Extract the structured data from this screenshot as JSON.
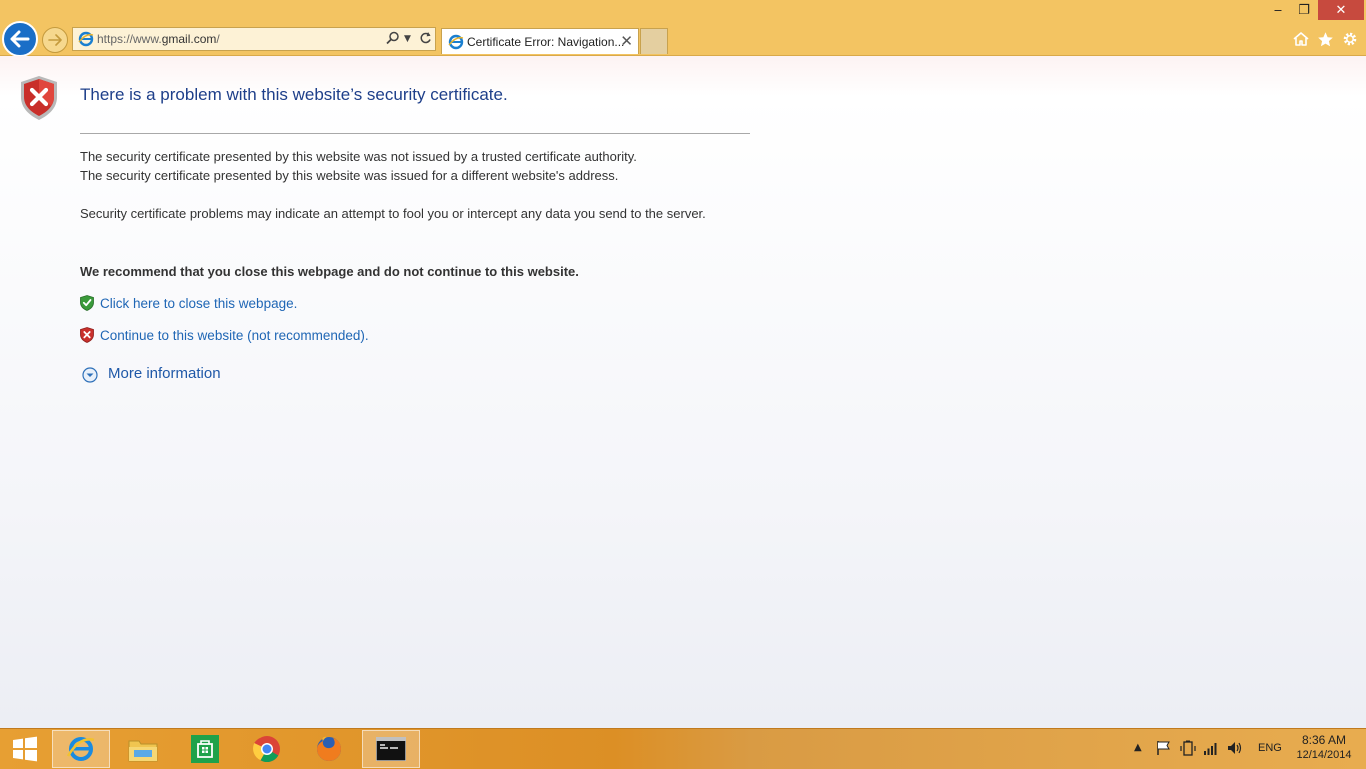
{
  "browser": {
    "url_scheme": "https://www.",
    "url_domain": "gmail.com",
    "url_path": "/",
    "tab_title": "Certificate Error: Navigation...",
    "window_controls": {
      "minimize": "‒",
      "restore": "❐",
      "close": "✕"
    },
    "toolbar_icons": [
      "home-icon",
      "favorites-star-icon",
      "tools-gear-icon"
    ]
  },
  "page": {
    "heading": "There is a problem with this website’s security certificate.",
    "line1": "The security certificate presented by this website was not issued by a trusted certificate authority.",
    "line2": "The security certificate presented by this website was issued for a different website's address.",
    "paragraph2": "Security certificate problems may indicate an attempt to fool you or intercept any data you send to the server.",
    "recommendation": "We recommend that you close this webpage and do not continue to this website.",
    "close_link": "Click here to close this webpage.",
    "continue_link": "Continue to this website (not recommended).",
    "more_info": "More information"
  },
  "taskbar": {
    "apps": [
      "start-button",
      "internet-explorer",
      "file-explorer",
      "store",
      "chrome",
      "firefox",
      "command-prompt"
    ],
    "language": "ENG",
    "time": "8:36 AM",
    "date": "12/14/2014"
  },
  "colors": {
    "chrome_bg": "#f3c462",
    "heading": "#1e3f8a",
    "link": "#1f66b5",
    "taskbar": "#dc8f25",
    "shield_red": "#c9302c",
    "shield_green": "#3a9a3a"
  }
}
